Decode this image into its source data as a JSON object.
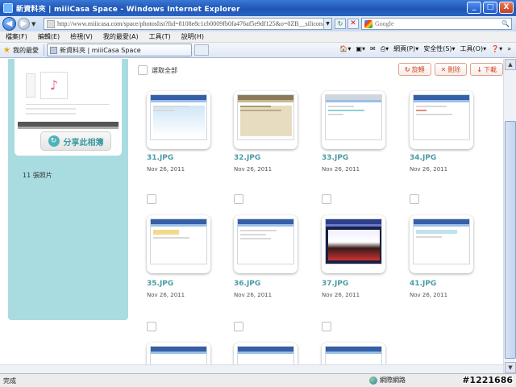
{
  "window": {
    "title": "新資料夾 | miiiCasa Space - Windows Internet Explorer",
    "min": "_",
    "max": "□",
    "close": "X"
  },
  "address": {
    "url": "http://www.miiicasa.com/space/photoslist?fid=8108e8c1cb0009fb0fa476af5e9df125&o=0ZB__silicon/power_i",
    "search_placeholder": "Google"
  },
  "menu": [
    "檔案(F)",
    "編輯(E)",
    "檢視(V)",
    "我的最愛(A)",
    "工具(T)",
    "說明(H)"
  ],
  "favorites": {
    "label": "我的最愛",
    "tab_label": "新資料夾 | miiiCasa Space",
    "commands": [
      "網頁(P)",
      "安全性(S)",
      "工具(O)"
    ]
  },
  "sidebar": {
    "share_label": "分享此相簿",
    "photo_count": "11 張照片"
  },
  "toolbar": {
    "select_all": "選取全部",
    "rotate": "旋轉",
    "delete": "刪除",
    "download": "下載"
  },
  "photos": [
    {
      "name": "31.JPG",
      "date": "Nov 26, 2011"
    },
    {
      "name": "32.JPG",
      "date": "Nov 26, 2011"
    },
    {
      "name": "33.JPG",
      "date": "Nov 26, 2011"
    },
    {
      "name": "34.JPG",
      "date": "Nov 26, 2011"
    },
    {
      "name": "35.JPG",
      "date": "Nov 26, 2011"
    },
    {
      "name": "36.JPG",
      "date": "Nov 26, 2011"
    },
    {
      "name": "37.JPG",
      "date": "Nov 26, 2011"
    },
    {
      "name": "41.JPG",
      "date": "Nov 26, 2011"
    }
  ],
  "status": {
    "text": "完成",
    "zone": "網際網路",
    "watermark": "#1221686"
  },
  "colors": {
    "accent": "#4a9ca5",
    "sidebar": "#a9dce0",
    "action": "#d4532e"
  }
}
